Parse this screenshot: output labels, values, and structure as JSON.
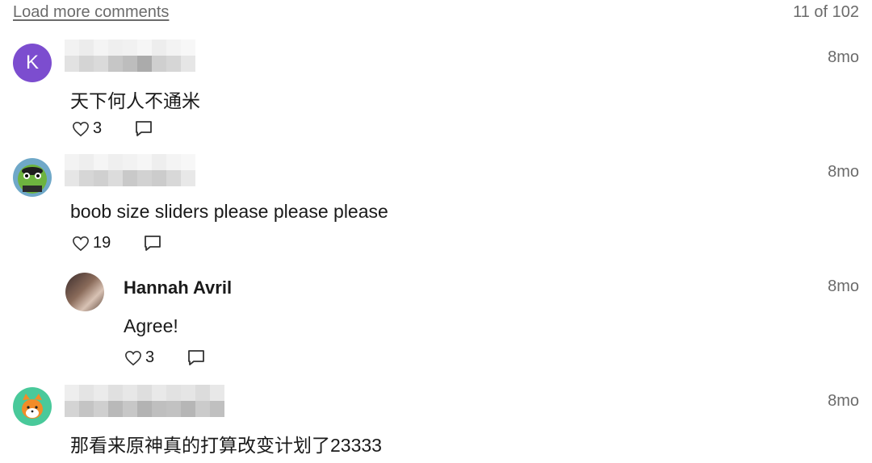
{
  "header": {
    "load_more": "Load more comments",
    "count": "11 of 102"
  },
  "comments": [
    {
      "avatar_letter": "K",
      "time": "8mo",
      "text": "天下何人不通米",
      "likes": "3"
    },
    {
      "time": "8mo",
      "text": "boob size sliders please please please",
      "likes": "19"
    },
    {
      "name": "Hannah Avril",
      "time": "8mo",
      "text": "Agree!",
      "likes": "3"
    },
    {
      "time": "8mo",
      "text": "那看来原神真的打算改变计划了23333"
    }
  ],
  "icons": [
    "heart-outline-icon",
    "reply-bubble-icon"
  ],
  "colors": {
    "accent_avatar": "#7c4dcf",
    "muted_text": "#6b6b6b"
  }
}
